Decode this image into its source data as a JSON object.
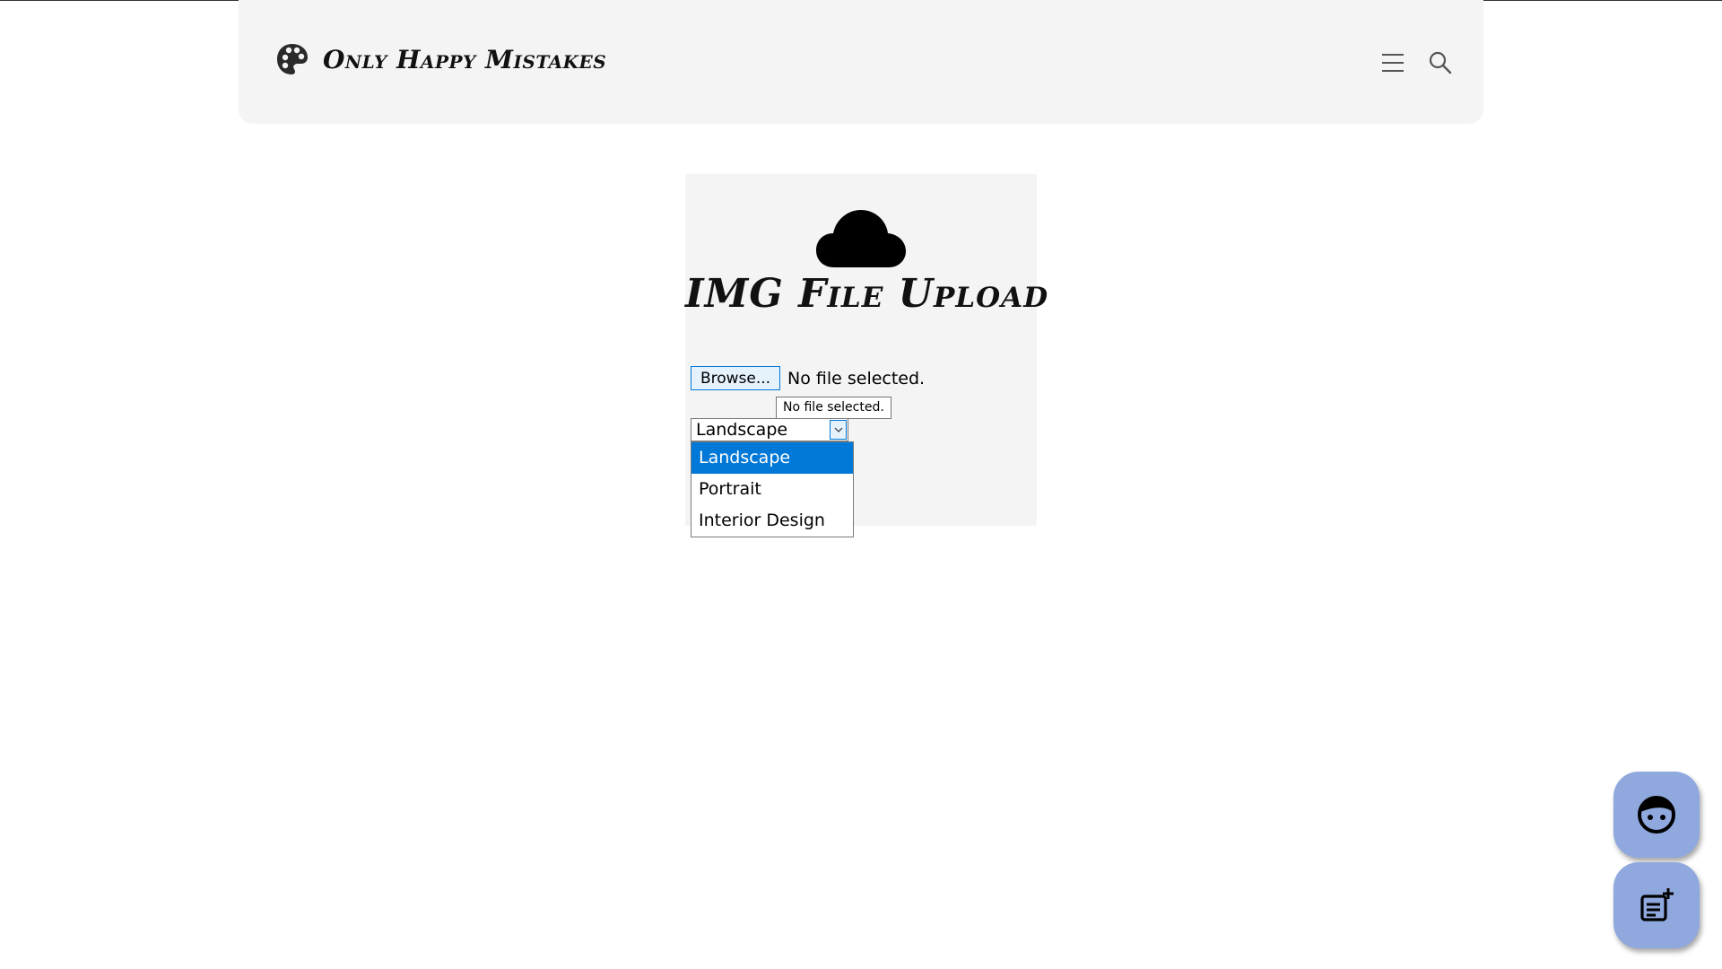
{
  "header": {
    "brand_name": "Only Happy Mistakes",
    "icons": [
      "palette-icon",
      "menu-icon",
      "search-icon"
    ]
  },
  "upload": {
    "title": "IMG File Upload",
    "icon": "cloud-icon",
    "browse_label": "Browse...",
    "file_status": "No file selected.",
    "tooltip": "No file selected."
  },
  "category_select": {
    "value": "Landscape",
    "options": [
      "Landscape",
      "Portrait",
      "Interior Design"
    ],
    "highlighted": "Landscape"
  },
  "fabs": [
    {
      "icon": "face-icon"
    },
    {
      "icon": "new-post-icon"
    }
  ],
  "colors": {
    "header_bg": "#f4f4f4",
    "card_bg": "#f4f4f4",
    "fab_bg": "#8fa8de",
    "selection": "#0078d7"
  }
}
